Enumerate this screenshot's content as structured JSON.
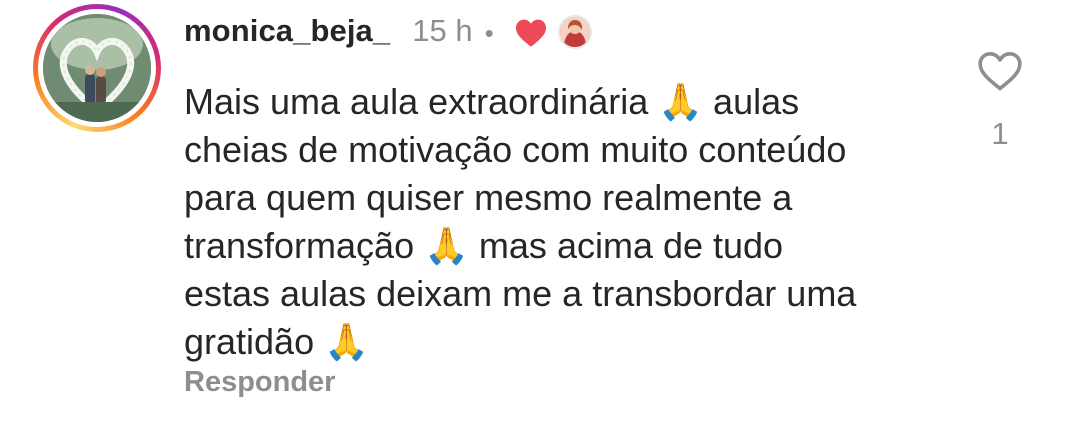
{
  "comment": {
    "username": "monica_beja_",
    "time": "15 h",
    "separator": "•",
    "text": "Mais uma aula extraordinária 🙏 aulas\ncheias de motivação com muito conteúdo\npara quem quiser mesmo realmente a\ntransformação 🙏 mas acima de tudo\nestas aulas deixam me a transbordar uma\ngratidão 🙏",
    "reply_label": "Responder",
    "like_count": "1",
    "creator_liked": true
  },
  "icons": {
    "like": "heart-outline-icon",
    "creator_like": "heart-filled-icon"
  },
  "colors": {
    "text": "#262626",
    "muted": "#8e8e8e",
    "heart_red": "#ed4956"
  }
}
